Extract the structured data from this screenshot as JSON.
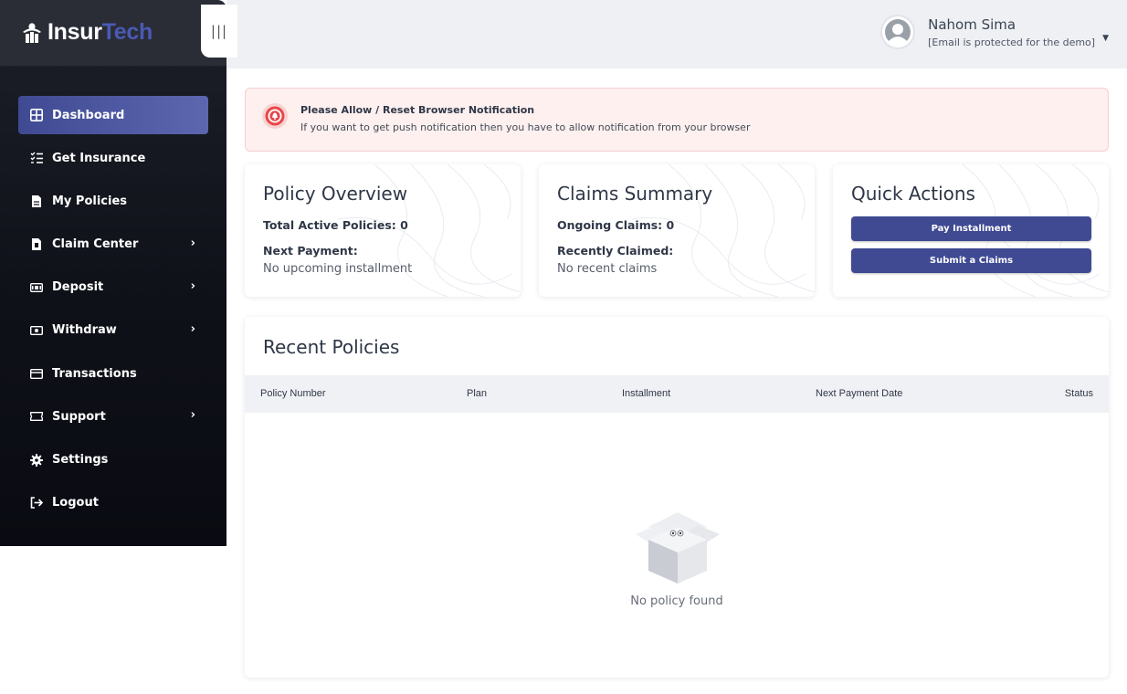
{
  "brand": {
    "name_part1": "Insur",
    "name_part2": "Tech"
  },
  "collapse_toggle": {
    "label": "|||"
  },
  "sidebar": {
    "items": [
      {
        "label": "Dashboard",
        "icon": "grid-icon",
        "active": true,
        "has_submenu": false
      },
      {
        "label": "Get Insurance",
        "icon": "list-check-icon",
        "active": false,
        "has_submenu": false
      },
      {
        "label": "My Policies",
        "icon": "document-icon",
        "active": false,
        "has_submenu": false
      },
      {
        "label": "Claim Center",
        "icon": "file-icon",
        "active": false,
        "has_submenu": true
      },
      {
        "label": "Deposit",
        "icon": "cash-icon",
        "active": false,
        "has_submenu": true
      },
      {
        "label": "Withdraw",
        "icon": "money-icon",
        "active": false,
        "has_submenu": true
      },
      {
        "label": "Transactions",
        "icon": "card-icon",
        "active": false,
        "has_submenu": false
      },
      {
        "label": "Support",
        "icon": "ticket-icon",
        "active": false,
        "has_submenu": true
      },
      {
        "label": "Settings",
        "icon": "gear-icon",
        "active": false,
        "has_submenu": false
      },
      {
        "label": "Logout",
        "icon": "logout-icon",
        "active": false,
        "has_submenu": false
      }
    ],
    "chevron": "›"
  },
  "user": {
    "name": "Nahom Sima",
    "email": "[Email is protected for the demo]",
    "caret": "▼"
  },
  "notification": {
    "title": "Please Allow / Reset Browser Notification",
    "text": "If you want to get push notification then you have to allow notification from your browser"
  },
  "policy_overview": {
    "title": "Policy Overview",
    "total_active": "Total Active Policies: 0",
    "next_payment_label": "Next Payment:",
    "next_payment_value": "No upcoming installment"
  },
  "claims_summary": {
    "title": "Claims Summary",
    "ongoing": "Ongoing Claims: 0",
    "recently_label": "Recently Claimed:",
    "recently_value": "No recent claims"
  },
  "quick_actions": {
    "title": "Quick Actions",
    "pay_button": "Pay Installment",
    "submit_button": "Submit a Claims"
  },
  "recent_policies": {
    "title": "Recent Policies",
    "columns": [
      "Policy Number",
      "Plan",
      "Installment",
      "Next Payment Date",
      "Status"
    ],
    "empty_text": "No policy found"
  },
  "colors": {
    "primary": "#3f4a93",
    "brand_tech": "#4a5ab3",
    "sidebar_bg": "#0f1119",
    "notice_bg": "#fdf0ef",
    "notice_icon": "#e8464a"
  }
}
